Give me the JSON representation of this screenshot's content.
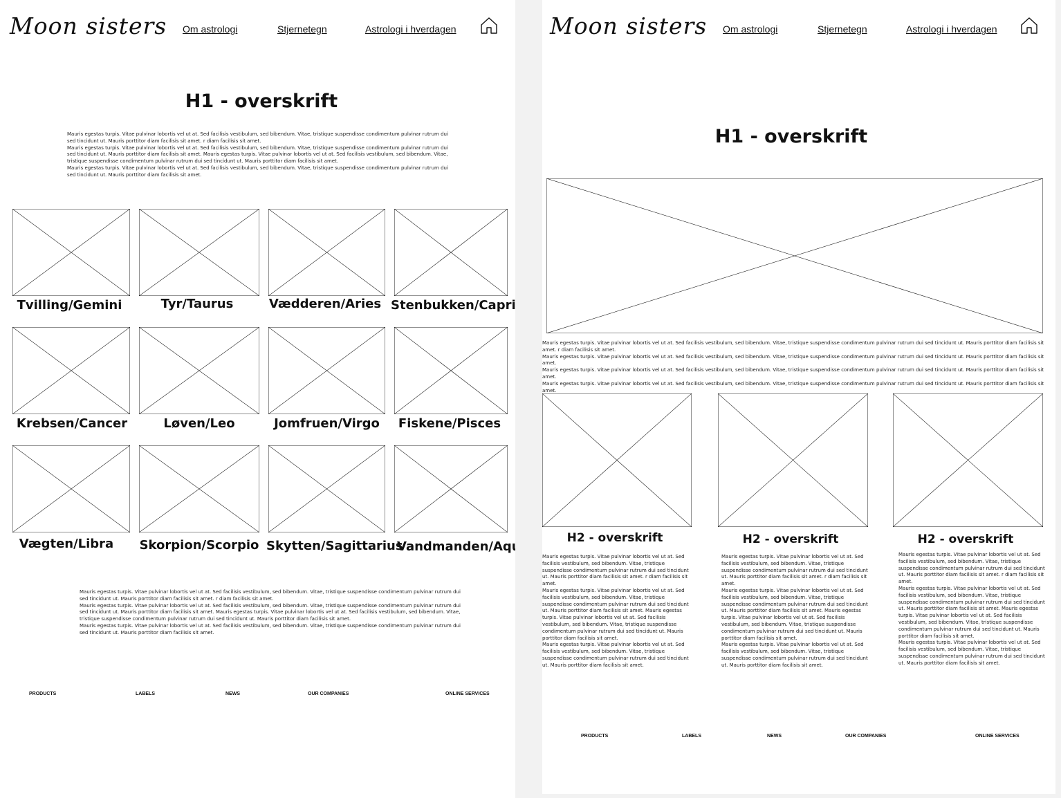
{
  "header": {
    "logo": "Moon sisters",
    "nav": [
      "Om astrologi",
      "Stjernetegn",
      "Astrologi i hverdagen"
    ],
    "home_icon": "home-icon"
  },
  "left": {
    "h1": "H1 - overskrift",
    "intro": [
      "Mauris egestas turpis. Vitae pulvinar lobortis vel ut at. Sed facilisis vestibulum, sed bibendum. Vitae, tristique suspendisse condimentum pulvinar rutrum dui sed tincidunt ut. Mauris porttitor diam facilisis sit amet. r diam facilisis sit amet.",
      "Mauris egestas turpis. Vitae pulvinar lobortis vel ut at. Sed facilisis vestibulum, sed bibendum. Vitae, tristique suspendisse condimentum pulvinar rutrum dui sed tincidunt ut. Mauris porttitor diam facilisis sit amet. Mauris egestas turpis. Vitae pulvinar lobortis vel ut at. Sed facilisis vestibulum, sed bibendum. Vitae, tristique suspendisse condimentum pulvinar rutrum dui sed tincidunt ut. Mauris porttitor diam facilisis sit amet.",
      "Mauris egestas turpis. Vitae pulvinar lobortis vel ut at. Sed facilisis vestibulum, sed bibendum. Vitae, tristique suspendisse condimentum pulvinar rutrum dui sed tincidunt ut. Mauris porttitor diam facilisis sit amet."
    ],
    "zodiac": [
      "Tvilling/Gemini",
      "Tyr/Taurus",
      "Vædderen/Aries",
      "Stenbukken/Caprico",
      "Krebsen/Cancer",
      "Løven/Leo",
      "Jomfruen/Virgo",
      "Fiskene/Pisces",
      "Vægten/Libra",
      "Skorpion/Scorpio",
      "Skytten/Sagittarius",
      "Vandmanden/Aqua"
    ],
    "outro": [
      "Mauris egestas turpis. Vitae pulvinar lobortis vel ut at. Sed facilisis vestibulum, sed bibendum. Vitae, tristique suspendisse condimentum pulvinar rutrum dui sed tincidunt ut. Mauris porttitor diam facilisis sit amet. r diam facilisis sit amet.",
      "Mauris egestas turpis. Vitae pulvinar lobortis vel ut at. Sed facilisis vestibulum, sed bibendum. Vitae, tristique suspendisse condimentum pulvinar rutrum dui sed tincidunt ut. Mauris porttitor diam facilisis sit amet. Mauris egestas turpis. Vitae pulvinar lobortis vel ut at. Sed facilisis vestibulum, sed bibendum. Vitae, tristique suspendisse condimentum pulvinar rutrum dui sed tincidunt ut. Mauris porttitor diam facilisis sit amet.",
      "Mauris egestas turpis. Vitae pulvinar lobortis vel ut at. Sed facilisis vestibulum, sed bibendum. Vitae, tristique suspendisse condimentum pulvinar rutrum dui sed tincidunt ut. Mauris porttitor diam facilisis sit amet."
    ]
  },
  "right": {
    "h1": "H1 - overskrift",
    "hero_text": [
      "Mauris egestas turpis. Vitae pulvinar lobortis vel ut at. Sed facilisis vestibulum, sed bibendum. Vitae, tristique suspendisse condimentum pulvinar rutrum dui sed tincidunt ut. Mauris porttitor diam facilisis sit amet. r diam facilisis sit amet.",
      "Mauris egestas turpis. Vitae pulvinar lobortis vel ut at. Sed facilisis vestibulum, sed bibendum. Vitae, tristique suspendisse condimentum pulvinar rutrum dui sed tincidunt ut. Mauris porttitor diam facilisis sit amet.",
      "Mauris egestas turpis. Vitae pulvinar lobortis vel ut at. Sed facilisis vestibulum, sed bibendum. Vitae, tristique suspendisse condimentum pulvinar rutrum dui sed tincidunt ut. Mauris porttitor diam facilisis sit amet.",
      "Mauris egestas turpis. Vitae pulvinar lobortis vel ut at. Sed facilisis vestibulum, sed bibendum. Vitae, tristique suspendisse condimentum pulvinar rutrum dui sed tincidunt ut. Mauris porttitor diam facilisis sit amet."
    ],
    "cards": [
      {
        "title": "H2 - overskrift",
        "text": [
          "Mauris egestas turpis. Vitae pulvinar lobortis vel ut at. Sed facilisis vestibulum, sed bibendum. Vitae, tristique suspendisse condimentum pulvinar rutrum dui sed tincidunt ut. Mauris porttitor diam facilisis sit amet. r diam facilisis sit amet.",
          "Mauris egestas turpis. Vitae pulvinar lobortis vel ut at. Sed facilisis vestibulum, sed bibendum. Vitae, tristique suspendisse condimentum pulvinar rutrum dui sed tincidunt ut. Mauris porttitor diam facilisis sit amet. Mauris egestas turpis. Vitae pulvinar lobortis vel ut at. Sed facilisis vestibulum, sed bibendum. Vitae, tristique suspendisse condimentum pulvinar rutrum dui sed tincidunt ut. Mauris porttitor diam facilisis sit amet.",
          "Mauris egestas turpis. Vitae pulvinar lobortis vel ut at. Sed facilisis vestibulum, sed bibendum. Vitae, tristique suspendisse condimentum pulvinar rutrum dui sed tincidunt ut. Mauris porttitor diam facilisis sit amet."
        ]
      },
      {
        "title": "H2 - overskrift",
        "text": [
          "Mauris egestas turpis. Vitae pulvinar lobortis vel ut at. Sed facilisis vestibulum, sed bibendum. Vitae, tristique suspendisse condimentum pulvinar rutrum dui sed tincidunt ut. Mauris porttitor diam facilisis sit amet. r diam facilisis sit amet.",
          "Mauris egestas turpis. Vitae pulvinar lobortis vel ut at. Sed facilisis vestibulum, sed bibendum. Vitae, tristique suspendisse condimentum pulvinar rutrum dui sed tincidunt ut. Mauris porttitor diam facilisis sit amet. Mauris egestas turpis. Vitae pulvinar lobortis vel ut at. Sed facilisis vestibulum, sed bibendum. Vitae, tristique suspendisse condimentum pulvinar rutrum dui sed tincidunt ut. Mauris porttitor diam facilisis sit amet.",
          "Mauris egestas turpis. Vitae pulvinar lobortis vel ut at. Sed facilisis vestibulum, sed bibendum. Vitae, tristique suspendisse condimentum pulvinar rutrum dui sed tincidunt ut. Mauris porttitor diam facilisis sit amet."
        ]
      },
      {
        "title": "H2 - overskrift",
        "text": [
          "Mauris egestas turpis. Vitae pulvinar lobortis vel ut at. Sed facilisis vestibulum, sed bibendum. Vitae, tristique suspendisse condimentum pulvinar rutrum dui sed tincidunt ut. Mauris porttitor diam facilisis sit amet. r diam facilisis sit amet.",
          "Mauris egestas turpis. Vitae pulvinar lobortis vel ut at. Sed facilisis vestibulum, sed bibendum. Vitae, tristique suspendisse condimentum pulvinar rutrum dui sed tincidunt ut. Mauris porttitor diam facilisis sit amet. Mauris egestas turpis. Vitae pulvinar lobortis vel ut at. Sed facilisis vestibulum, sed bibendum. Vitae, tristique suspendisse condimentum pulvinar rutrum dui sed tincidunt ut. Mauris porttitor diam facilisis sit amet.",
          "Mauris egestas turpis. Vitae pulvinar lobortis vel ut at. Sed facilisis vestibulum, sed bibendum. Vitae, tristique suspendisse condimentum pulvinar rutrum dui sed tincidunt ut. Mauris porttitor diam facilisis sit amet."
        ]
      }
    ]
  },
  "footer": [
    "PRODUCTS",
    "LABELS",
    "NEWS",
    "OUR COMPANIES",
    "ONLINE SERVICES"
  ]
}
